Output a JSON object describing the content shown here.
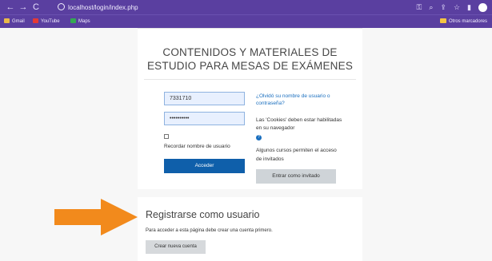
{
  "browser": {
    "url": "localhost/login/index.php",
    "bookmarks": [
      {
        "label": "Gmail",
        "color": "#e9b949"
      },
      {
        "label": "YouTube",
        "color": "#e53935"
      },
      {
        "label": "Maps",
        "color": "#34a853"
      }
    ],
    "other_bookmarks": "Otros marcadores"
  },
  "login": {
    "site_title": "CONTENIDOS Y MATERIALES DE ESTUDIO PARA MESAS DE EXÁMENES",
    "username_value": "7331710",
    "password_value": "••••••••••",
    "remember_label": "Recordar nombre de usuario",
    "login_button": "Acceder",
    "forgot_link": "¿Olvidó su nombre de usuario o contraseña?",
    "cookies_notice": "Las 'Cookies' deben estar habilitadas en su navegador",
    "guest_notice": "Algunos cursos permiten el acceso de invitados",
    "guest_button": "Entrar como invitado"
  },
  "signup": {
    "title": "Registrarse como usuario",
    "note": "Para acceder a esta página debe crear una cuenta primero.",
    "create_button": "Crear nueva cuenta"
  },
  "colors": {
    "browser_chrome": "#5a3fa0",
    "primary_button": "#0f5faa",
    "arrow": "#f28a1c"
  }
}
